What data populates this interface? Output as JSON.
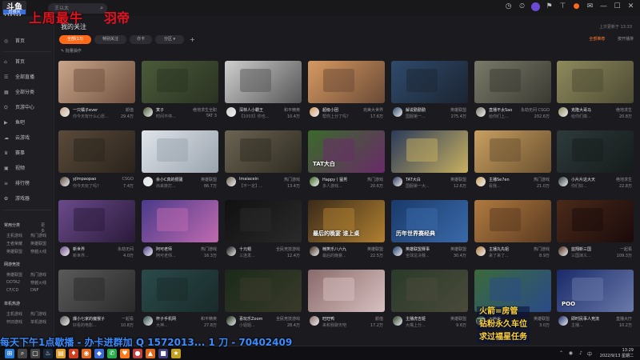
{
  "overlay": {
    "logo": "斗鱼",
    "live_badge": "直播间",
    "room_id": "274234",
    "heading_left": "上周最牛",
    "heading_right": "羽帝",
    "bottom_scroll": "每天下午1点歇播 - 办卡进群加 Q 1572013... 1 刀 - 70402409",
    "rocket_lines": [
      "火箭=房管",
      "钻粉永久车位",
      "求过福星任务"
    ]
  },
  "titlebar": {
    "search_placeholder": "王以太",
    "icons": [
      "history-icon",
      "clock-icon",
      "avatar",
      "gift-icon",
      "shirt-icon",
      "bell-icon",
      "mail-icon",
      "minimize-icon",
      "maximize-icon",
      "close-icon"
    ]
  },
  "sidebar": {
    "items": [
      {
        "icon": "◎",
        "label": "首页"
      },
      {
        "icon": "⌂",
        "label": "首页"
      },
      {
        "icon": "☰",
        "label": "全部直播"
      },
      {
        "icon": "▦",
        "label": "全部分类"
      },
      {
        "icon": "⛭",
        "label": "页游中心"
      },
      {
        "icon": "▶",
        "label": "鱼吧"
      },
      {
        "icon": "☁",
        "label": "云游戏"
      },
      {
        "icon": "♛",
        "label": "赛事"
      },
      {
        "icon": "▣",
        "label": "视频"
      },
      {
        "icon": "≡",
        "label": "排行榜"
      },
      {
        "icon": "✿",
        "label": "游戏器"
      }
    ],
    "sections": [
      {
        "title": "常用分类",
        "more": "更多",
        "subs": [
          [
            "主机游戏",
            "热门游戏"
          ],
          [
            "王者荣耀",
            "英雄联盟"
          ],
          [
            "英雄联盟",
            "穿越火线"
          ]
        ]
      },
      {
        "title": "网游竞技",
        "more": "",
        "subs": [
          [
            "英雄联盟",
            "热门游戏"
          ],
          [
            "DOTA2",
            "穿越火线"
          ],
          [
            "CF/CD",
            "DNF"
          ]
        ]
      },
      {
        "title": "单机热游",
        "more": "",
        "subs": [
          [
            "主机游戏",
            "热门游戏"
          ],
          [
            "怀旧游戏",
            "单机游戏"
          ]
        ]
      }
    ]
  },
  "main": {
    "title": "我的关注",
    "update_time": "上次更新于 13:33",
    "tabs": [
      "全部(13)",
      "特别关注",
      "亦卡",
      "分区"
    ],
    "manage": "批量操作",
    "actions": [
      "全部推荐",
      "按开播排"
    ]
  },
  "cards": [
    {
      "name": "一只橘子ever",
      "cat": "颜值",
      "title": "你今天有什么心愿...",
      "views": "29.4万"
    },
    {
      "name": "寅子",
      "cat": "绝地求生全职",
      "title": "时间不停...",
      "views": "TAT 3"
    },
    {
      "name": "深林人小霸王",
      "cat": "和平精英",
      "title": "【1003】你也...",
      "views": "10.4万"
    },
    {
      "name": "超级小团",
      "cat": "完美大世界",
      "title": "帮你上分了吗?",
      "views": "17.6万"
    },
    {
      "name": "解说勤勤勤",
      "cat": "英雄联盟",
      "title": "国服第一...",
      "views": "275.4万"
    },
    {
      "name": "直播不太Sao",
      "cat": "永劫无间 CSGO",
      "title": "给你们上...",
      "views": "202.6万"
    },
    {
      "name": "克隆大哥马",
      "cat": "绝地求生",
      "title": "给你们做...",
      "views": "20.8万"
    },
    {
      "name": "yjlmpaopao",
      "cat": "CSGO",
      "title": "你今天玩了吗?",
      "views": "7.4万"
    },
    {
      "name": "余小C真的很骚",
      "cat": "英雄联盟",
      "title": "出来挨打...",
      "views": "86.7万"
    },
    {
      "name": "lmaiacein",
      "cat": "热门游戏",
      "title": "【不一定】...",
      "views": "13.4万"
    },
    {
      "name": "Happy丨猛男",
      "cat": "热门游戏",
      "title": "多人游戏...",
      "views": "20.6万"
    },
    {
      "name": "TAT大白",
      "cat": "英雄联盟",
      "title": "国服第一大...",
      "views": "12.6万"
    },
    {
      "name": "主播Se7en",
      "cat": "热门游戏",
      "title": "看我...",
      "views": "21.0万"
    },
    {
      "name": "小片片这大天",
      "cat": "绝地求生",
      "title": "你们好...",
      "views": "22.8万"
    },
    {
      "name": "新世界",
      "cat": "永劫无间",
      "title": "新世界...",
      "views": "4.0万"
    },
    {
      "name": "阿可老师",
      "cat": "热门游戏",
      "title": "阿可老师...",
      "views": "16.3万"
    },
    {
      "name": "十元帽",
      "cat": "全民竞技游戏",
      "title": "三连发...",
      "views": "12.4万"
    },
    {
      "name": "楠笑乐八六九",
      "cat": "英雄联盟",
      "title": "最后的晚宴...",
      "views": "22.5万"
    },
    {
      "name": "英雄联盟赛事",
      "cat": "英雄联盟",
      "title": "全球总决赛...",
      "views": "30.4万"
    },
    {
      "name": "主播丸先姐",
      "cat": "热门游戏",
      "title": "来了来了...",
      "views": "8.9万"
    },
    {
      "name": "蓝翔新三国",
      "cat": "一起看",
      "title": "三国演义...",
      "views": "109.3万"
    },
    {
      "name": "爆小七家的魔猴子",
      "cat": "一起看",
      "title": "好看的电影...",
      "views": "10.8万"
    },
    {
      "name": "杯子手机网",
      "cat": "和平精英",
      "title": "大神...",
      "views": "27.8万"
    },
    {
      "name": "喜玩乐Zoom",
      "cat": "全民竞技游戏",
      "title": "小姐姐...",
      "views": "28.4万"
    },
    {
      "name": "旺旺鸭",
      "cat": "颜值",
      "title": "来和我聊天吧",
      "views": "17.2万"
    },
    {
      "name": "主播虎吉姬",
      "cat": "英雄联盟",
      "title": "大嘴上分...",
      "views": "9.6万"
    },
    {
      "name": "火箭手",
      "cat": "英雄联盟",
      "title": "进群...",
      "views": "3.0万"
    },
    {
      "name": "即时民事人竞流",
      "cat": "直播大厅",
      "title": "主播...",
      "views": "10.2万"
    }
  ],
  "thumb_texts": [
    "",
    "",
    "",
    "",
    "",
    "",
    "",
    "",
    "",
    "",
    "TAT大白",
    "",
    "",
    "",
    "",
    "",
    "",
    "最后的晚宴 谁上桌",
    "历年世界赛经典",
    "",
    "",
    "",
    "",
    "",
    "",
    "",
    "",
    "POO"
  ],
  "taskbar": {
    "time": "13:29",
    "date": "2022/9/13 星期二",
    "lang": "中",
    "icons": [
      "windows-icon",
      "search-icon",
      "taskview-icon",
      "steam-icon",
      "folder-icon",
      "game-icon",
      "browser-icon",
      "app-icon",
      "wechat-icon",
      "douyu-icon",
      "app-icon",
      "app-icon",
      "app-icon",
      "app-icon"
    ]
  }
}
